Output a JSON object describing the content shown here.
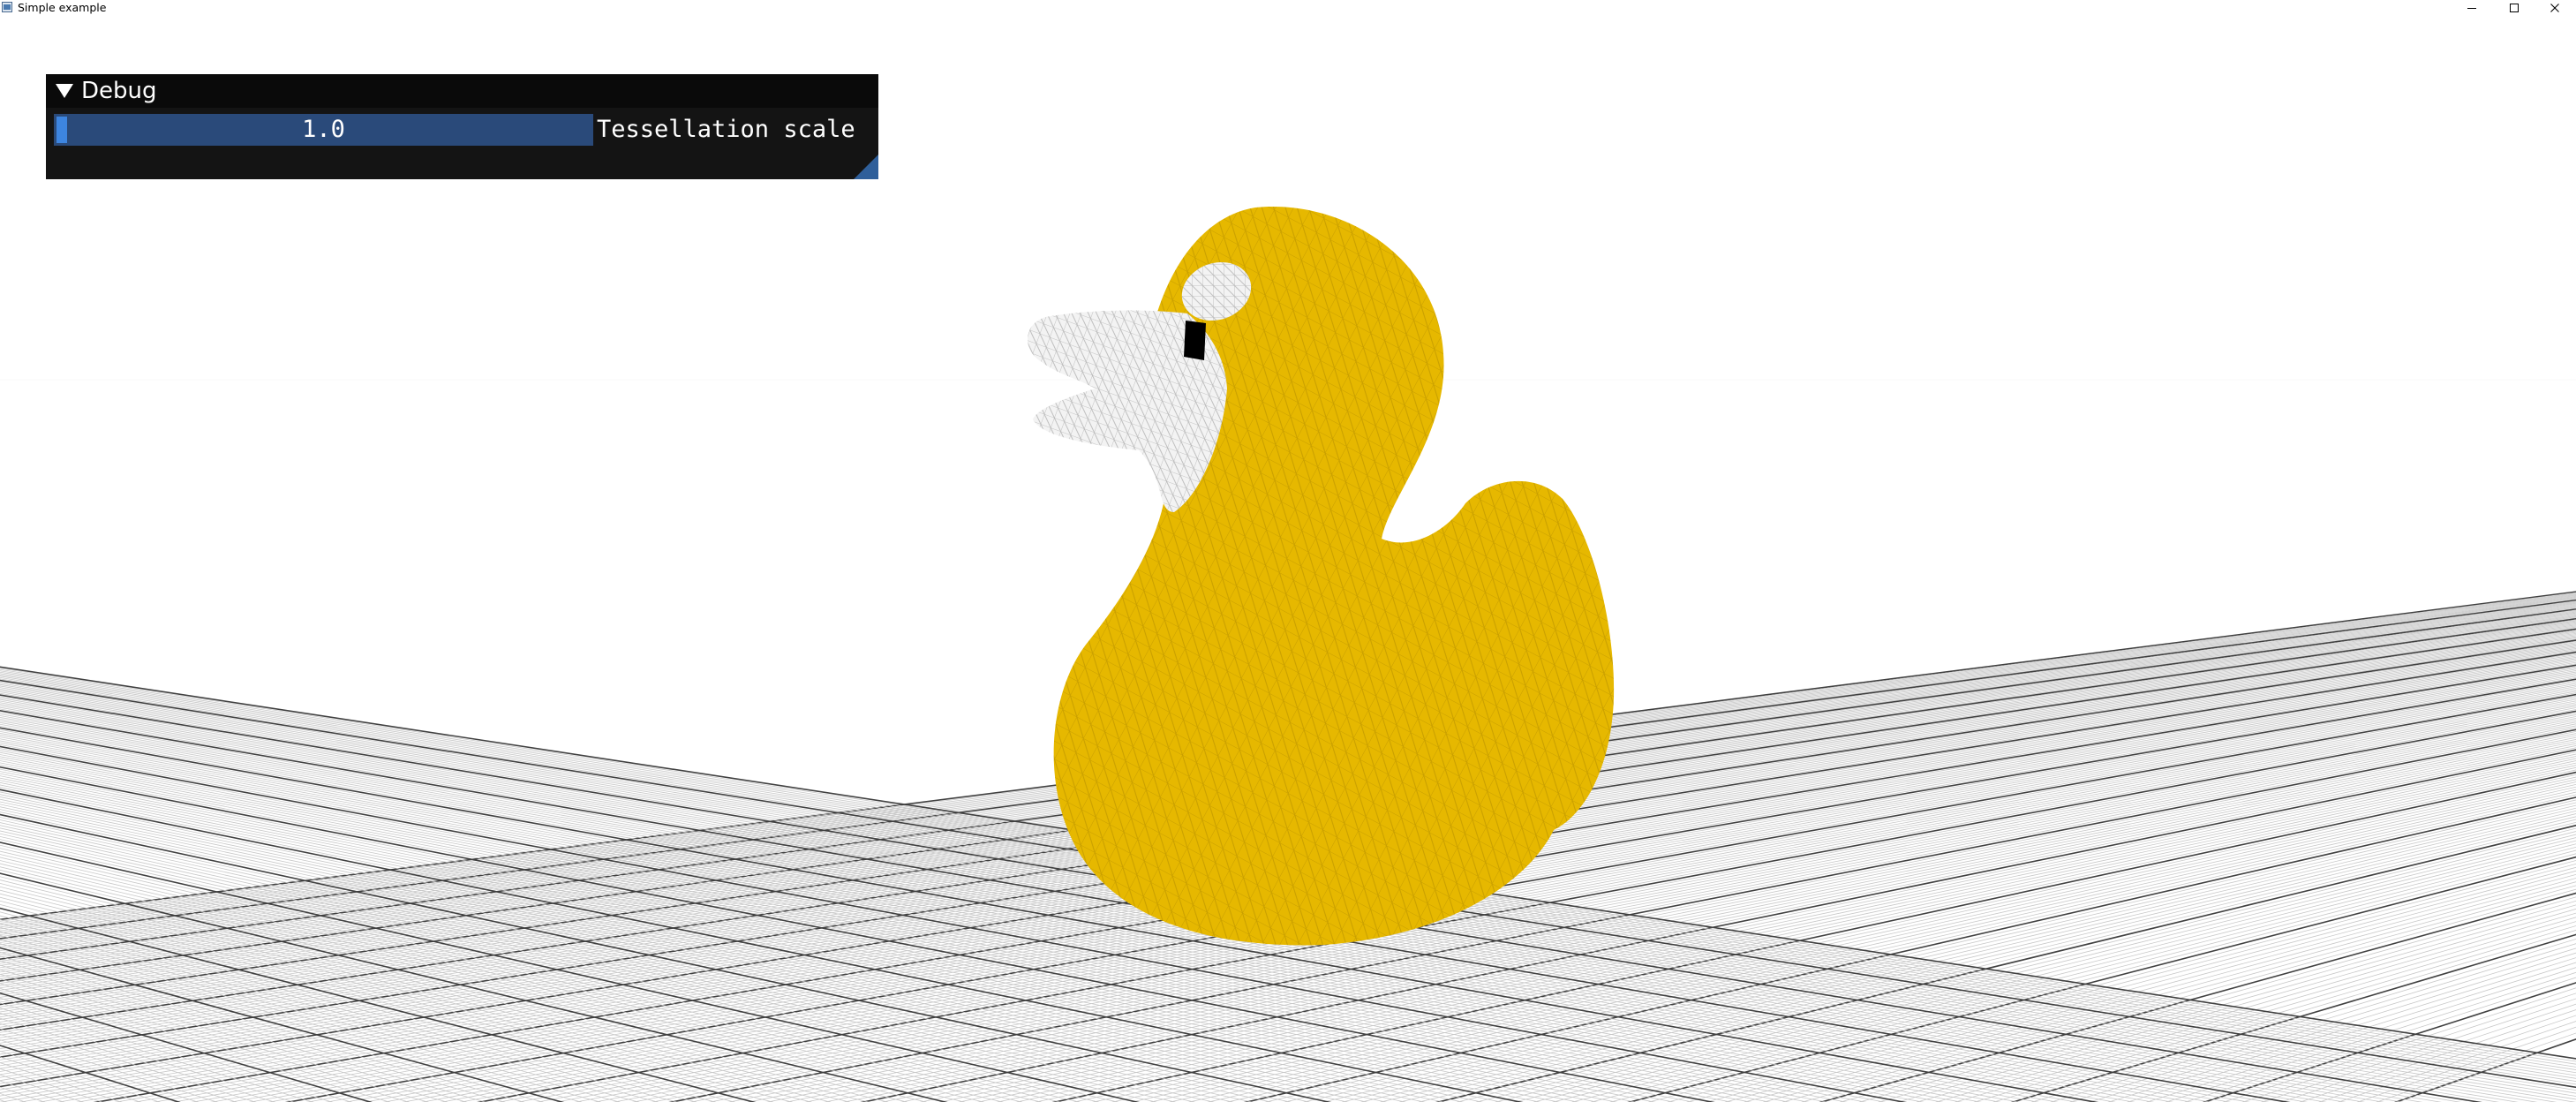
{
  "window": {
    "title": "Simple example",
    "icons": {
      "app": "app-icon",
      "minimize": "minimize-icon",
      "maximize": "maximize-icon",
      "close": "close-icon"
    }
  },
  "debug_panel": {
    "title": "Debug",
    "collapse_icon": "triangle-down-icon",
    "slider": {
      "value": "1.0",
      "label": "Tessellation scale",
      "level": 0.0
    },
    "colors": {
      "background": "#141414",
      "titlebar": "#0a0a0a",
      "slider_frame": "#2a4a7a",
      "slider_grab": "#3d85e0",
      "resize_grip": "#2f5f9a"
    }
  },
  "scene": {
    "object": "rubber-duck-wireframe",
    "colors": {
      "duck_body": "#e6b800",
      "duck_wire": "#b08a00",
      "beak_eye": "#f2f2f2",
      "pupil": "#000000",
      "grid_minor": "#c8c8c8",
      "grid_major": "#404040",
      "background": "#ffffff"
    }
  }
}
